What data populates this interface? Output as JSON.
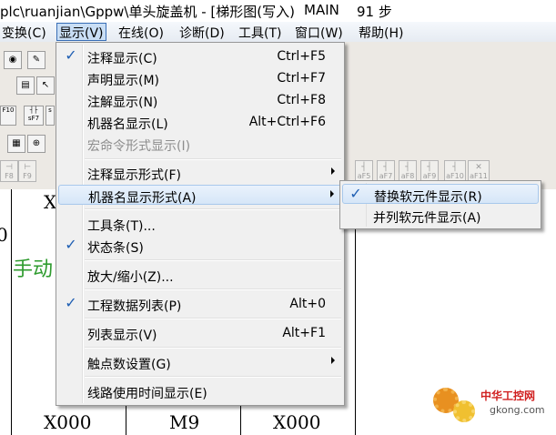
{
  "title": {
    "text": "plc\\ruanjian\\Gppw\\单头旋盖机 - [梯形图(写入)",
    "mode": "MAIN",
    "steps": "91 步"
  },
  "menubar": [
    "变换(C)",
    "显示(V)",
    "在线(O)",
    "诊断(D)",
    "工具(T)",
    "窗口(W)",
    "帮助(H)"
  ],
  "display_menu": {
    "items": [
      {
        "label": "注释显示(C)",
        "shortcut": "Ctrl+F5",
        "checked": true
      },
      {
        "label": "声明显示(M)",
        "shortcut": "Ctrl+F7"
      },
      {
        "label": "注解显示(N)",
        "shortcut": "Ctrl+F8"
      },
      {
        "label": "机器名显示(L)",
        "shortcut": "Alt+Ctrl+F6"
      },
      {
        "label": "宏命令形式显示(I)",
        "disabled": true
      },
      {
        "label": "注释显示形式(F)",
        "submenu": true
      },
      {
        "label": "机器名显示形式(A)",
        "submenu": true,
        "highlighted": true
      },
      {
        "label": "工具条(T)..."
      },
      {
        "label": "状态条(S)",
        "checked": true
      },
      {
        "label": "放大/缩小(Z)..."
      },
      {
        "label": "工程数据列表(P)",
        "shortcut": "Alt+0",
        "checked": true
      },
      {
        "label": "列表显示(V)",
        "shortcut": "Alt+F1"
      },
      {
        "label": "触点数设置(G)",
        "submenu": true
      },
      {
        "label": "线路使用时间显示(E)"
      }
    ]
  },
  "submenu": {
    "items": [
      {
        "label": "替换软元件显示(R)",
        "checked": true
      },
      {
        "label": "并列软元件显示(A)"
      }
    ]
  },
  "toolbar": {
    "fkeys_left": [
      "F8",
      "F9"
    ],
    "fkeys_right": [
      "aF5",
      "aF7",
      "aF8",
      "aF9",
      "aF10",
      "aF11"
    ],
    "row2_labels": [
      "F10",
      "sF7",
      "s"
    ]
  },
  "ladder": {
    "top_contact": "X",
    "left_number": "0",
    "green_text": "手动",
    "bottom_row": [
      "X000",
      "M9",
      "X000"
    ]
  },
  "watermark": {
    "brand": "中华工控网",
    "site": "gkong.com"
  },
  "colors": {
    "menu_bg": "#f0f0f0",
    "highlight": "#d6e6f8",
    "check": "#1f5fb3",
    "green_text": "#2e9b2e"
  }
}
